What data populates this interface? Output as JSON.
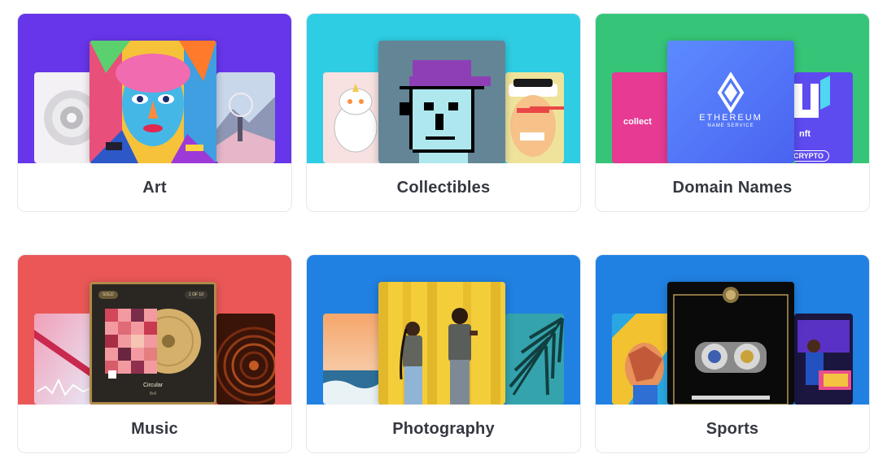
{
  "categories": [
    {
      "label": "Art",
      "banner_color": "#6736ea"
    },
    {
      "label": "Collectibles",
      "banner_color": "#2fcde3"
    },
    {
      "label": "Domain Names",
      "banner_color": "#36c578"
    },
    {
      "label": "Music",
      "banner_color": "#eb5757"
    },
    {
      "label": "Photography",
      "banner_color": "#2081e2"
    },
    {
      "label": "Sports",
      "banner_color": "#2081e2"
    }
  ],
  "domain_thumbs": {
    "left_text": "collect",
    "center_line1": "ETHEREUM",
    "center_line2": "NAME SERVICE",
    "right_text": "nft",
    "right_pill": "CRYPTO"
  },
  "music_thumb": {
    "badge_left": "SOLD",
    "badge_right": "1 OF 10",
    "title": "Circular",
    "subtitle": "Bell"
  }
}
